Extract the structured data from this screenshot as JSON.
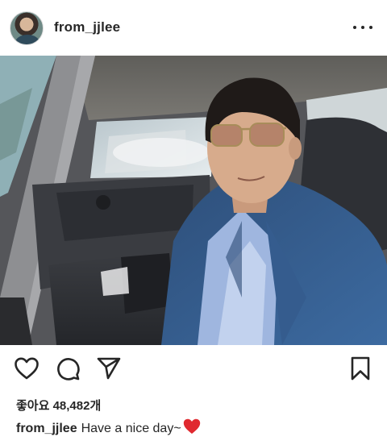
{
  "post": {
    "username": "from_jjlee",
    "image_alt": "Selfie of a man in sunglasses and a blue corduroy jacket sitting in a car"
  },
  "icons": {
    "more": "more-horizontal-icon",
    "like": "heart-outline-icon",
    "comment": "comment-bubble-icon",
    "share": "paper-plane-icon",
    "save": "bookmark-icon"
  },
  "likes": {
    "label": "좋아요",
    "count": "48,482",
    "unit": "개"
  },
  "caption": {
    "username": "from_jjlee",
    "text": "Have a nice day~",
    "emoji": "red-heart-emoji"
  },
  "colors": {
    "text": "#262626",
    "background": "#ffffff",
    "heart_emoji": "#e0292f"
  }
}
